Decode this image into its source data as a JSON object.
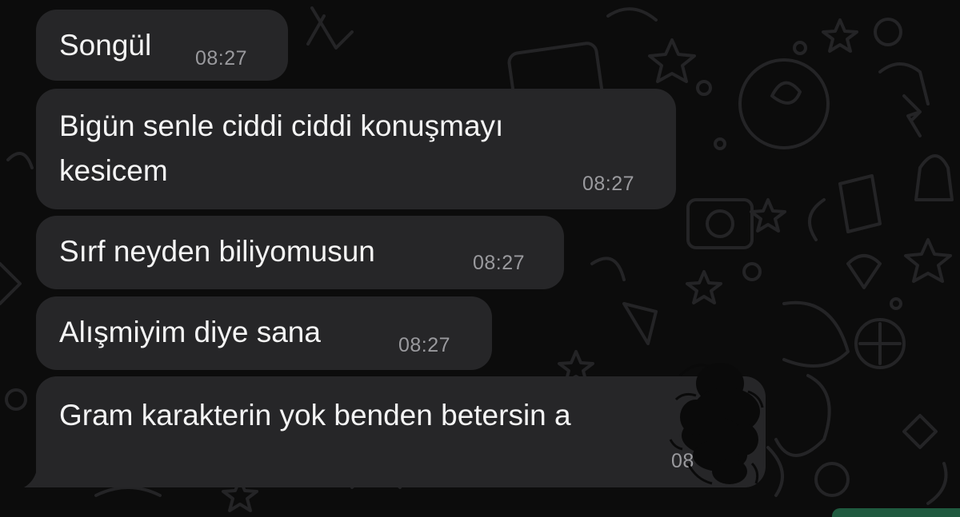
{
  "chat": {
    "messages": [
      {
        "text_lines": [
          "Songül"
        ],
        "time": "08:27"
      },
      {
        "text_lines": [
          "Bigün senle ciddi ciddi konuşmayı",
          "kesicem"
        ],
        "time": "08:27"
      },
      {
        "text_lines": [
          "Sırf neyden biliyomusun"
        ],
        "time": "08:27"
      },
      {
        "text_lines": [
          "Alışmiyim diye sana"
        ],
        "time": "08:27"
      },
      {
        "text_lines": [
          "Gram karakterin yok benden betersin a"
        ],
        "time": "08"
      }
    ]
  },
  "colors": {
    "background": "#0c0c0c",
    "bubble_incoming": "#262628",
    "text": "#f4f4f4",
    "timestamp": "#9a9a9e",
    "outgoing_bubble_edge": "#1f5a3f"
  }
}
